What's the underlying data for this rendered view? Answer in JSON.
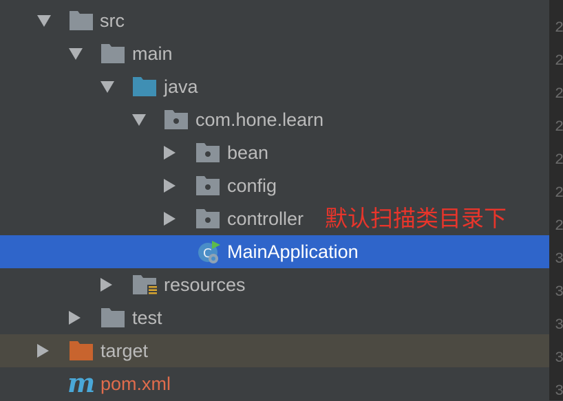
{
  "tree": {
    "src": "src",
    "main": "main",
    "java": "java",
    "package": "com.hone.learn",
    "bean": "bean",
    "config": "config",
    "controller": "controller",
    "main_application": "MainApplication",
    "resources": "resources",
    "test": "test",
    "target": "target",
    "pom": "pom.xml"
  },
  "annotation": "默认扫描类目录下",
  "colors": {
    "background": "#3c3f41",
    "selection": "#2f65ca",
    "excluded_row": "#4c4a42",
    "folder": "#8a9299",
    "source_folder": "#3f8fb4",
    "excluded_folder": "#c8642e",
    "annotation": "#e8352b",
    "pom_label": "#e06c4c",
    "maven_icon": "#4aa8d8"
  },
  "icons": {
    "expanded": "triangle-down-icon",
    "collapsed": "triangle-right-icon",
    "folder": "folder-icon",
    "package": "package-icon",
    "spring_boot_class": "spring-boot-class-icon",
    "maven": "maven-icon"
  },
  "gutter": [
    "2",
    "2",
    "2",
    "2",
    "2",
    "2",
    "2",
    "3",
    "3",
    "3",
    "3",
    "3"
  ]
}
